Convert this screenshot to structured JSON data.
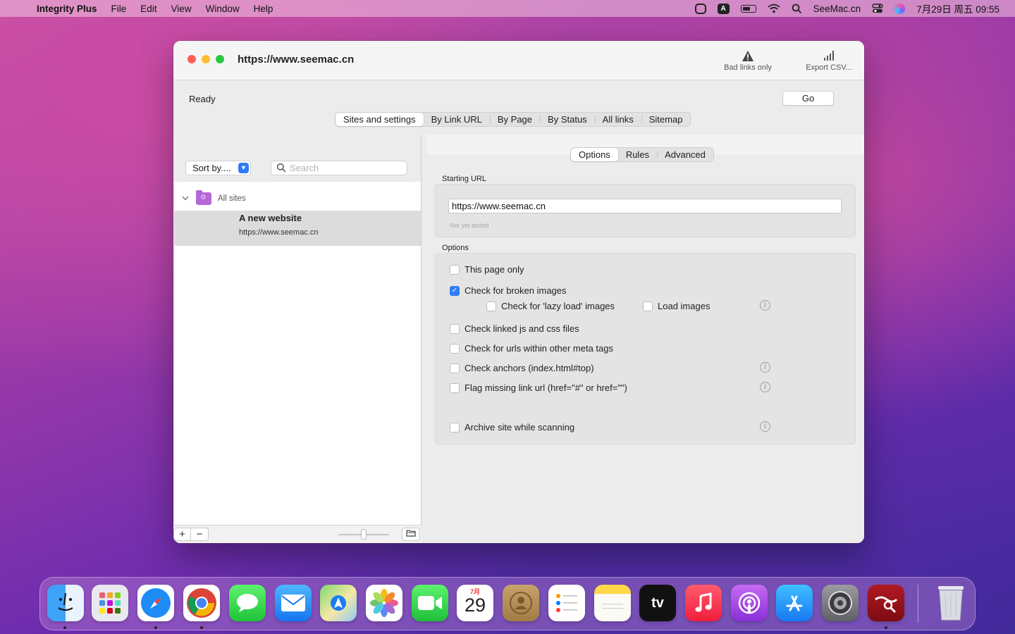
{
  "menubar": {
    "app_name": "Integrity Plus",
    "menus": [
      "File",
      "Edit",
      "View",
      "Window",
      "Help"
    ],
    "input_indicator": "A",
    "site_label": "SeeMac.cn",
    "datetime": "7月29日 周五 09:55"
  },
  "window": {
    "title": "https://www.seemac.cn",
    "toolbar": {
      "bad_links_label": "Bad links only",
      "export_label": "Export CSV..."
    },
    "status": "Ready",
    "go_label": "Go",
    "main_tabs": [
      "Sites and settings",
      "By Link URL",
      "By Page",
      "By Status",
      "All links",
      "Sitemap"
    ],
    "active_main_tab": 0
  },
  "sidebar": {
    "sort_label": "Sort by....",
    "search_placeholder": "Search",
    "group_label": "All sites",
    "site": {
      "name": "A new website",
      "url": "https://www.seemac.cn"
    }
  },
  "settings": {
    "sub_tabs": [
      "Options",
      "Rules",
      "Advanced"
    ],
    "active_sub_tab": 0,
    "starting_url_label": "Starting URL",
    "starting_url_value": "https://www.seemac.cn",
    "url_status": "Not yet tested",
    "options_label": "Options",
    "options": [
      {
        "label": "This page only",
        "checked": false
      },
      {
        "label": "Check for broken images",
        "checked": true
      },
      {
        "label": "Check for 'lazy load' images",
        "checked": false
      },
      {
        "label": "Load images",
        "checked": false
      },
      {
        "label": "Check linked js and css files",
        "checked": false
      },
      {
        "label": "Check for urls within other meta tags",
        "checked": false
      },
      {
        "label": "Check anchors (index.html#top)",
        "checked": false
      },
      {
        "label": "Flag missing link url (href=\"#\" or href=\"\")",
        "checked": false
      },
      {
        "label": "Archive site while scanning",
        "checked": false
      }
    ]
  },
  "dock": {
    "calendar_month": "7月",
    "calendar_day": "29",
    "tv_label": "tv",
    "apps": [
      "Finder",
      "Launchpad",
      "Safari",
      "Chrome",
      "Messages",
      "Mail",
      "Maps",
      "Photos",
      "FaceTime",
      "Calendar",
      "Contacts",
      "Reminders",
      "Notes",
      "TV",
      "Music",
      "Podcasts",
      "App Store",
      "System Preferences",
      "Integrity Plus",
      "Trash"
    ]
  },
  "colors": {
    "accent": "#2f7cf6",
    "close": "#ff5f57",
    "minimize": "#febc2e",
    "maximize": "#28c840",
    "selected_row": "#dcdcdc"
  }
}
